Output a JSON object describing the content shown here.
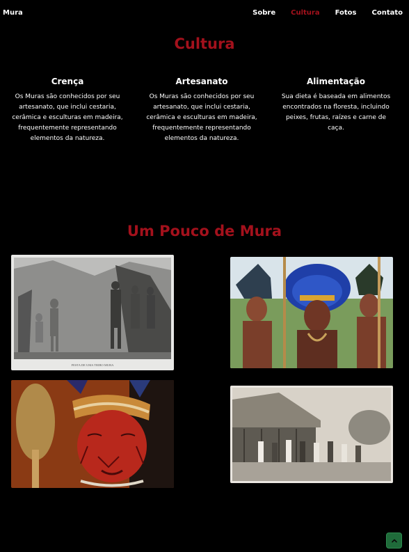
{
  "header": {
    "brand": "Mura",
    "nav": [
      {
        "label": "Sobre"
      },
      {
        "label": "Cultura"
      },
      {
        "label": "Fotos"
      },
      {
        "label": "Contato"
      }
    ],
    "active_item": "Cultura"
  },
  "cultura": {
    "title": "Cultura",
    "columns": [
      {
        "heading": "Crença",
        "text": "Os Muras são conhecidos por seu artesanato, que inclui cestaria, cerâmica e esculturas em madeira, frequentemente representando elementos da natureza."
      },
      {
        "heading": "Artesanato",
        "text": "Os Muras são conhecidos por seu artesanato, que inclui cestaria, cerâmica e esculturas em madeira, frequentemente representando elementos da natureza."
      },
      {
        "heading": "Alimentação",
        "text": "Sua dieta é baseada em alimentos encontrados na floresta, incluindo peixes, frutas, raízes e carne de caça."
      }
    ]
  },
  "gallery": {
    "title": "Um Pouco de Mura",
    "engraving_caption": "FESTA DE UMA TRIBO MURA"
  },
  "back_to_top": {
    "icon": "chevron-up-icon"
  },
  "colors": {
    "background": "#000000",
    "accent": "#a3111c",
    "text": "#ffffff",
    "back_to_top": "#1f6b3a"
  }
}
